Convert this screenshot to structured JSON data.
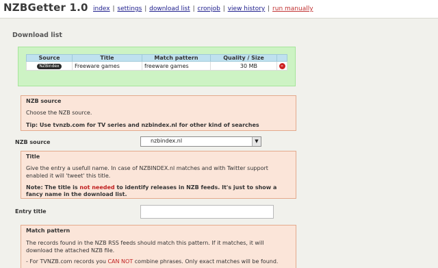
{
  "header": {
    "app_title": "NZBGetter 1.0",
    "nav": [
      {
        "label": "index"
      },
      {
        "label": "settings"
      },
      {
        "label": "download list"
      },
      {
        "label": "cronjob"
      },
      {
        "label": "view history"
      },
      {
        "label": "run manually"
      }
    ],
    "separator": "|"
  },
  "main": {
    "section_title": "Download list",
    "download_table": {
      "columns": [
        "Source",
        "Title",
        "Match pattern",
        "Quality / Size"
      ],
      "rows": [
        {
          "source": "NZBindex",
          "title": "Freeware games",
          "pattern": "freeware games",
          "quality": "30 MB"
        }
      ]
    },
    "nzb_source_box": {
      "title": "NZB source",
      "desc": "Choose the NZB source.",
      "tip": "Tip: Use tvnzb.com for TV series and nzbindex.nl for other kind of searches"
    },
    "nzb_source_field": {
      "label": "NZB source",
      "value": "nzbindex.nl"
    },
    "title_box": {
      "title": "Title",
      "line1": "Give the entry a usefull name. In case of NZBINDEX.nl matches and with Twitter support",
      "line2": "enabled it will 'tweet' this title.",
      "note_a": "Note: The title is ",
      "note_red": "not needed",
      "note_b": " to identify releases in NZB feeds. It's just to show a",
      "note_line2": "fancy name in the download list."
    },
    "entry_title_field": {
      "label": "Entry title",
      "value": ""
    },
    "match_box": {
      "title": "Match pattern",
      "line1": "The records found in the NZB RSS feeds should match this pattern. If it matches, it will",
      "line2": "download the attached NZB file.",
      "line3_a": "- For TVNZB.com records you ",
      "line3_red": "CAN NOT",
      "line3_b": " combine phrases. Only exact matches will be found."
    },
    "colors": {
      "accent_green": "#cdf3c4",
      "info_peach": "#fbe5d9",
      "header_blue": "#bfe1ef"
    }
  }
}
